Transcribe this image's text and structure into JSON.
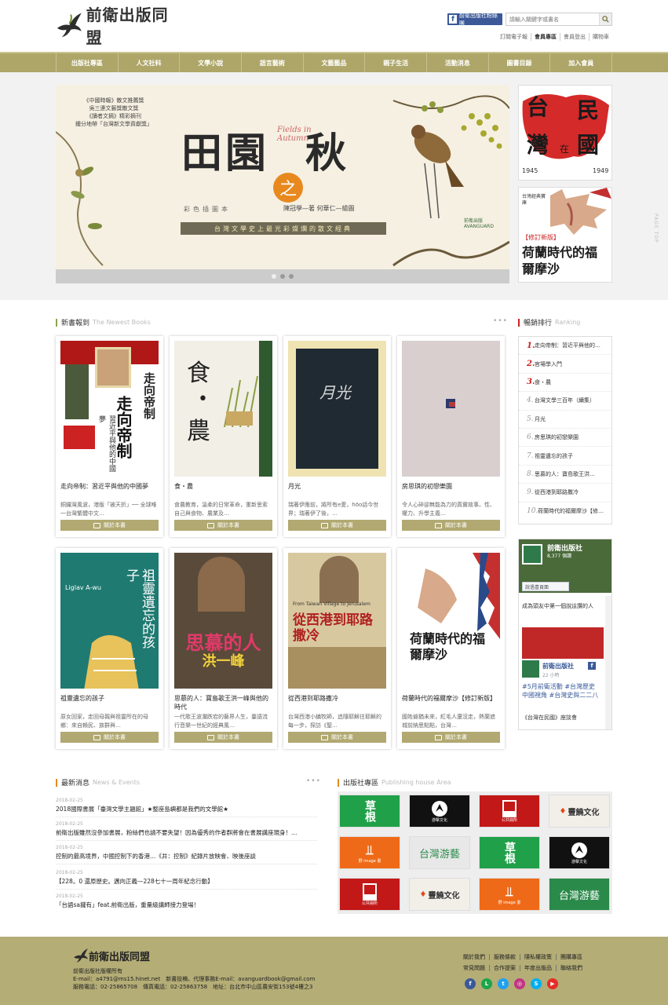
{
  "header": {
    "logo_text": "前衛出版同盟",
    "fb_label": "前衛出版社粉絲團",
    "search_placeholder": "請輸入關鍵字或書名",
    "top_links": [
      "訂閱電子報",
      "會員專區",
      "會員登出",
      "購物車"
    ]
  },
  "nav": [
    "出版社專區",
    "人文社科",
    "文學小說",
    "語言藝術",
    "文藝藝品",
    "親子生活",
    "活動消息",
    "圖書目錄",
    "加入會員"
  ],
  "banner": {
    "award_lines": [
      "《中國時報》散文推薦獎",
      "吳三連文藝獎散文獎",
      "《讀者文摘》精彩摘刊",
      "鍾分地帶「台灣新文學貢獻獎」"
    ],
    "title_a": "田園",
    "title_zhi": "之",
    "title_b": "秋",
    "title_en": "Fields in Autumn",
    "subtitle": "彩色插圖本",
    "author": "陳冠學—著 何華仁—繪圖",
    "strip": "台灣文學史上最光彩燦爛的散文經典",
    "publisher": "前衛出版 AVANGUARD"
  },
  "side_ads": {
    "ad1_title_a": "台",
    "ad1_title_b": "民",
    "ad1_title_c": "灣",
    "ad1_title_d": "國",
    "ad1_small": "在",
    "ad1_years_a": "1945",
    "ad1_years_b": "1949",
    "ad2_tag": "【修訂新版】",
    "ad2_title": "荷蘭時代的福爾摩沙",
    "ad2_series": "台灣經典寶庫"
  },
  "page_top": "PAGE TOP",
  "new_books": {
    "title": "新書報到",
    "title_en": "The Newest Books",
    "more": "•••",
    "about_label": "關於本書",
    "items": [
      {
        "title": "走向帝制：習近平與他的中國夢",
        "desc": "銅鑼灣風波，港版「被天折」── 全球唯一台灣繁體中文…"
      },
      {
        "title": "食・農",
        "desc": "食農教育，溫柔的日常革命，重新思索自己與食物、農業及…"
      },
      {
        "title": "月光",
        "desc": "瑞著伊應前，將所有e愛，hōo話今世界；瑞著伊了後，…"
      },
      {
        "title": "房思琪的初戀樂園",
        "desc": "令人心碎卻無能為力的真實故事。性、權力、升學主義…"
      },
      {
        "title": "祖靈遺忘的孩子",
        "desc": "原女回家，走回母親與祖靈所在的母鄉：來自賴民、族群與…"
      },
      {
        "title": "思慕的人：寶島歌王洪一峰與他的時代",
        "desc": "一代歌王波瀾跌宕的藝界人生，臺語流行音樂一世紀的經典風…"
      },
      {
        "title": "從西港到耶路撒冷",
        "desc": "台灣西港小鎮牧師，追隨耶穌往耶穌的每一步，探訪《聖…"
      },
      {
        "title": "荷蘭時代的福爾摩沙【修訂新版】",
        "desc": "國姓爺猶未來，紅毛人還沒走，熱蘭遮城前納思點點，台灣…"
      }
    ],
    "covers": {
      "c1_title": "走向帝制",
      "c1_sub": "習近平與他的中國夢",
      "c2_title_a": "食",
      "c2_title_b": "農",
      "c3_title": "月光",
      "c5_title": "祖靈遺忘的孩子",
      "c5_author": "Liglav A-wu",
      "c6_title": "思慕的人",
      "c6_name": "洪一峰",
      "c7_title": "從西港到耶路撒冷",
      "c7_en": "From Taiwan Village to Jerusalem",
      "c8_title": "荷蘭時代的福爾摩沙"
    }
  },
  "ranking": {
    "title": "暢銷排行",
    "title_en": "Ranking",
    "items": [
      {
        "n": "1.",
        "t": "走向帝制：習近平與他的…"
      },
      {
        "n": "2.",
        "t": "官場學入門"
      },
      {
        "n": "3.",
        "t": "食・農"
      },
      {
        "n": "4.",
        "t": "台灣文學三百年（續集）"
      },
      {
        "n": "5.",
        "t": "月光"
      },
      {
        "n": "6.",
        "t": "房思琪的初戀樂園"
      },
      {
        "n": "7.",
        "t": "祖靈遺忘的孩子"
      },
      {
        "n": "8.",
        "t": "思慕的人：寶島歌王洪…"
      },
      {
        "n": "9.",
        "t": "從西港到耶路撒冷"
      },
      {
        "n": "10.",
        "t": "荷蘭時代的福爾摩沙【修…"
      }
    ]
  },
  "facebook": {
    "page_name": "前衛出版社",
    "likes": "8,377 個讚",
    "post_link": "說過喜頁面",
    "post1": "成為頭友中第一個說這讚的人",
    "post_author": "前衛出版社",
    "post_time": "22 小時",
    "post_text": "#5月前衛活動 #台灣歷史中國視角 #台灣史與二二八",
    "post_more": "《台灣在民國》座談會"
  },
  "news": {
    "title": "最新消息",
    "title_en": "News & Events",
    "more": "•••",
    "items": [
      {
        "date": "2018-02-25",
        "text": "2018國際書展「臺灣文學主題館」★整座島嶼都是我們的文學館★"
      },
      {
        "date": "2018-02-25",
        "text": "前衛出版雖然沒參加書展，粉絲們也請不要失望！因為優秀的作者群將會在書展講座現身！…"
      },
      {
        "date": "2018-02-25",
        "text": "控制的最高境界，中國控制下的香港…《井：控制》紀錄片放映會、映後座談"
      },
      {
        "date": "2018-02-25",
        "text": "【228。0 還原歷史。邁向正義—228七十一周年紀念行動】"
      },
      {
        "date": "2018-02-25",
        "text": "「台語sa攏有」feat.前衛出版，重量級講師接力登場！"
      }
    ]
  },
  "publishers": {
    "title": "出版社專區",
    "title_en": "Publishing house Area",
    "tiles": [
      {
        "label": "草根",
        "sub": ""
      },
      {
        "label": "游擊文化",
        "sub": ""
      },
      {
        "label": "公共冊所",
        "sub": ""
      },
      {
        "label": "豐饒文化",
        "sub": ""
      },
      {
        "label": "",
        "sub": "野 image 書"
      },
      {
        "label": "台灣游藝",
        "sub": ""
      },
      {
        "label": "草根",
        "sub": ""
      },
      {
        "label": "游擊文化",
        "sub": ""
      },
      {
        "label": "公共冊所",
        "sub": ""
      },
      {
        "label": "豐饒文化",
        "sub": ""
      },
      {
        "label": "",
        "sub": "野 image 書"
      },
      {
        "label": "台灣游藝",
        "sub": ""
      }
    ]
  },
  "footer": {
    "logo_text": "前衛出版同盟",
    "rights": "前衛出版社版權所有",
    "email": "E-mail：a4791@ms15.hinet.net　新書投稿、代理事務E-mail：avanguardbook@gmail.com",
    "phone": "服務電話：02-25865708　傳真電話：02-25863758　地址：台北市中山區農安街153號4樓之3",
    "links_row1": [
      "關於我們",
      "服務條款",
      "隱私權政策",
      "團購專區"
    ],
    "links_row2": [
      "常見問題",
      "合作提案",
      "年度出版品",
      "聯絡我們"
    ]
  }
}
